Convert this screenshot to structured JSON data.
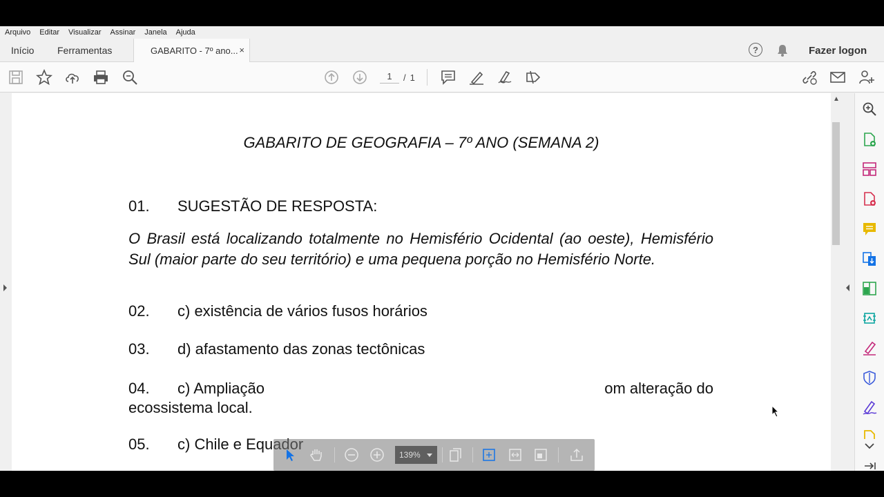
{
  "menu": [
    "Arquivo",
    "Editar",
    "Visualizar",
    "Assinar",
    "Janela",
    "Ajuda"
  ],
  "tabs": {
    "home": "Início",
    "tools": "Ferramentas",
    "doc": "GABARITO - 7º ano...",
    "close": "×"
  },
  "header": {
    "logon": "Fazer logon"
  },
  "page_nav": {
    "current": "1",
    "separator": "/",
    "total": "1"
  },
  "zoom": {
    "value": "139%"
  },
  "document": {
    "title": "GABARITO DE GEOGRAFIA – 7º ANO (SEMANA 2)",
    "q1": {
      "num": "01.",
      "text": "SUGESTÃO DE RESPOSTA:"
    },
    "q1_answer": "O Brasil está localizando totalmente no Hemisfério Ocidental (ao oeste), Hemisfério Sul (maior parte do seu território) e uma pequena porção no Hemisfério Norte.",
    "q2": {
      "num": "02.",
      "text": "c) existência de vários fusos horários"
    },
    "q3": {
      "num": "03.",
      "text": "d) afastamento das zonas tectônicas"
    },
    "q4": {
      "num": "04.",
      "text_left": "c) Ampliação",
      "text_right": "om alteração do",
      "line2": "ecossistema local."
    },
    "q5": {
      "num": "05.",
      "text": "c) Chile e Equador"
    }
  },
  "colors": {
    "accent_pdf_red": "#d6304f",
    "tool_green": "#2da64f",
    "tool_magenta": "#c4287a",
    "tool_yellow": "#e8b900",
    "tool_blue": "#1473e6"
  }
}
